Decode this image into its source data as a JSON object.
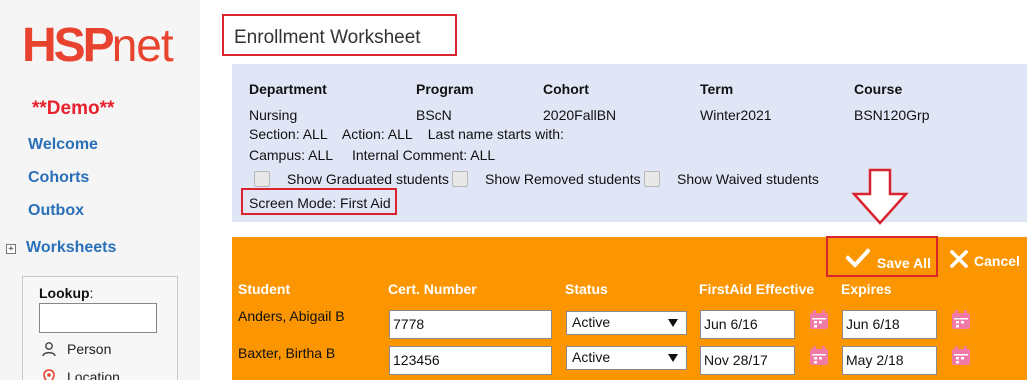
{
  "app": {
    "logo_primary": "HSP",
    "logo_secondary": "net",
    "demo_label": "**Demo**"
  },
  "sidebar": {
    "nav": [
      "Welcome",
      "Cohorts",
      "Outbox"
    ],
    "worksheets_label": "Worksheets",
    "lookup": {
      "label": "Lookup",
      "label_suffix": ":",
      "input_value": "",
      "options": [
        "Person",
        "Location"
      ]
    }
  },
  "page": {
    "title": "Enrollment Worksheet"
  },
  "info": {
    "headers": {
      "department": "Department",
      "program": "Program",
      "cohort": "Cohort",
      "term": "Term",
      "course": "Course"
    },
    "values": {
      "department": "Nursing",
      "program": "BScN",
      "cohort": "2020FallBN",
      "term": "Winter2021",
      "course": "BSN120Grp"
    },
    "filters_line": "Section: ALL    Action: ALL    Last name starts with:",
    "campus_line": "Campus: ALL     Internal Comment: ALL",
    "checkboxes": [
      {
        "label": "Show Graduated students",
        "checked": false
      },
      {
        "label": "Show Removed students",
        "checked": false
      },
      {
        "label": "Show Waived students",
        "checked": false
      }
    ],
    "screen_mode": "Screen Mode: First Aid"
  },
  "toolbar": {
    "save_all": "Save All",
    "cancel": "Cancel"
  },
  "table": {
    "columns": [
      "Student",
      "Cert. Number",
      "Status",
      "FirstAid Effective",
      "Expires"
    ],
    "rows": [
      {
        "student": "Anders, Abigail B",
        "cert": "7778",
        "status": "Active",
        "effective": "Jun 6/16",
        "expires": "Jun 6/18"
      },
      {
        "student": "Baxter, Birtha B",
        "cert": "123456",
        "status": "Active",
        "effective": "Nov 28/17",
        "expires": "May 2/18"
      }
    ]
  },
  "colors": {
    "accent_red": "#d9232e",
    "brand": "#e8432e",
    "link_blue": "#2a70b8",
    "orange": "#fb9600",
    "info_bg": "#e1e6f7",
    "calendar_pink": "#f07aa6"
  }
}
